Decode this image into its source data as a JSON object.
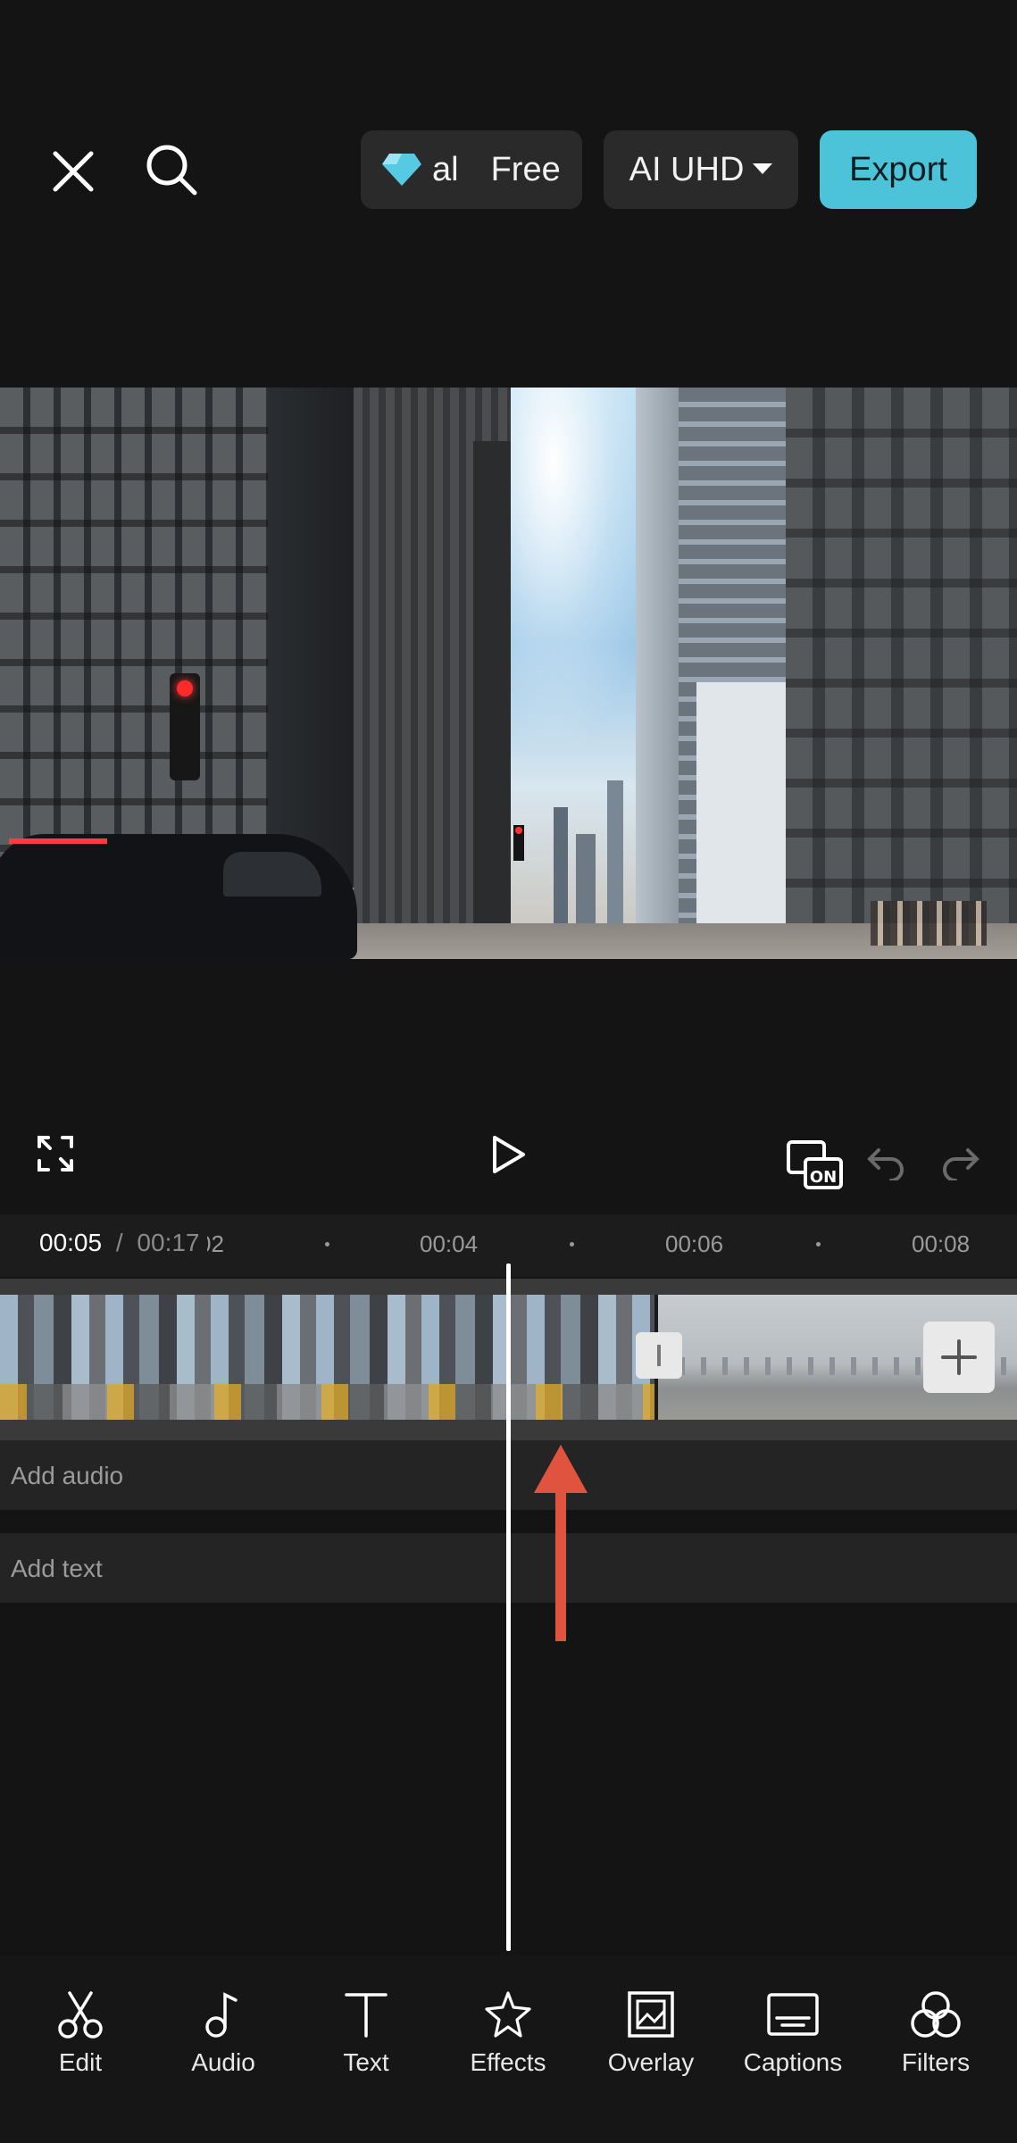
{
  "topbar": {
    "pro_badge_text": "al",
    "free_text": "Free",
    "resolution_label": "AI UHD",
    "export_label": "Export"
  },
  "timeline": {
    "current_time": "00:05",
    "separator": "/",
    "total_time": "00:17",
    "partial_tick": "02",
    "ticks": [
      "00:04",
      "00:06",
      "00:08"
    ]
  },
  "lanes": {
    "audio": "Add audio",
    "text": "Add text"
  },
  "toolbar": {
    "items": [
      {
        "label": "Edit",
        "icon": "scissors-icon"
      },
      {
        "label": "Audio",
        "icon": "music-note-icon"
      },
      {
        "label": "Text",
        "icon": "text-icon"
      },
      {
        "label": "Effects",
        "icon": "star-sparkle-icon"
      },
      {
        "label": "Overlay",
        "icon": "overlay-icon"
      },
      {
        "label": "Captions",
        "icon": "captions-icon"
      },
      {
        "label": "Filters",
        "icon": "filters-icon"
      }
    ]
  },
  "colors": {
    "accent": "#4cc3d9",
    "annotation_arrow": "#e0533f",
    "background": "#141414"
  }
}
